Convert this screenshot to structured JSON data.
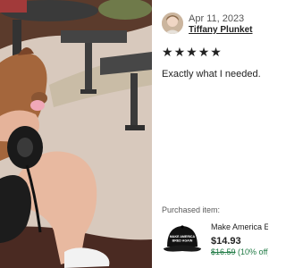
{
  "review": {
    "date": "Apr 11, 2023",
    "reviewer_name": "Tiffany Plunket",
    "rating": 5,
    "stars": [
      "★",
      "★",
      "★",
      "★",
      "★"
    ],
    "text": "Exactly what I needed."
  },
  "purchase": {
    "label": "Purchased item:",
    "item_title": "Make America E",
    "price": "$14.93",
    "original_price": "$16.59",
    "discount": "(10% off)",
    "hat_text_line1": "MAKE AMERICA",
    "hat_text_line2": "BRED AGAIN"
  },
  "colors": {
    "text_primary": "#222222",
    "text_secondary": "#595959",
    "sale_green": "#1f7a44",
    "hat_black": "#111111"
  }
}
